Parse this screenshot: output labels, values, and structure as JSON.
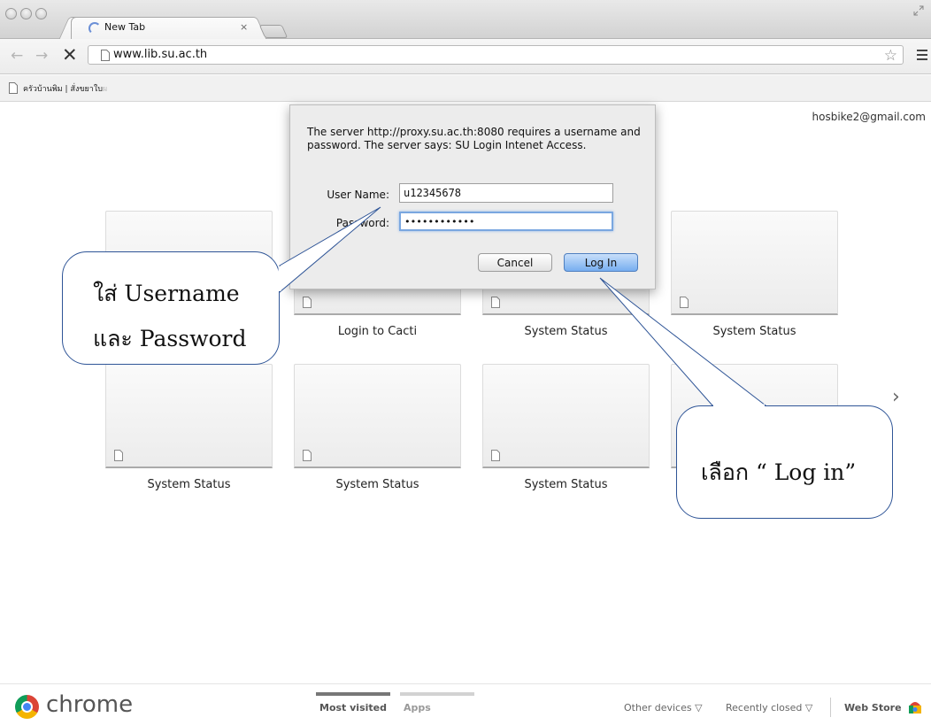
{
  "browser": {
    "tab_title": "New Tab",
    "tab_close": "×",
    "url": "www.lib.su.ac.th",
    "bookmark_label": "ครัวบ้านพิม | สั่งขยาใบ",
    "bookmark_fade": "ผ"
  },
  "page": {
    "user_email": "hosbike2@gmail.com",
    "tiles": [
      {
        "label": ""
      },
      {
        "label": "Login to Cacti"
      },
      {
        "label": "System Status"
      },
      {
        "label": "System Status"
      },
      {
        "label": "System Status"
      },
      {
        "label": "System Status"
      },
      {
        "label": "System Status"
      },
      {
        "label": ""
      }
    ],
    "next_arrow": "›"
  },
  "dialog": {
    "message": "The server http://proxy.su.ac.th:8080 requires a username and password. The server says: SU Login Intenet Access.",
    "username_label": "User Name:",
    "username_value": "u12345678",
    "password_label": "Password:",
    "password_value": "••••••••••••",
    "cancel_label": "Cancel",
    "login_label": "Log In"
  },
  "callouts": {
    "credentials_line1": "ใส่ Username",
    "credentials_line2": "และ Password",
    "login_hint": "เลือก “ Log in”"
  },
  "bottom_bar": {
    "brand": "chrome",
    "tab_most_visited": "Most visited",
    "tab_apps": "Apps",
    "other_devices": "Other devices ▽",
    "recently_closed": "Recently closed ▽",
    "web_store": "Web Store"
  },
  "colors": {
    "callout_border": "#2f5597",
    "login_button": "#77aef0",
    "dialog_bg": "#ececec"
  }
}
